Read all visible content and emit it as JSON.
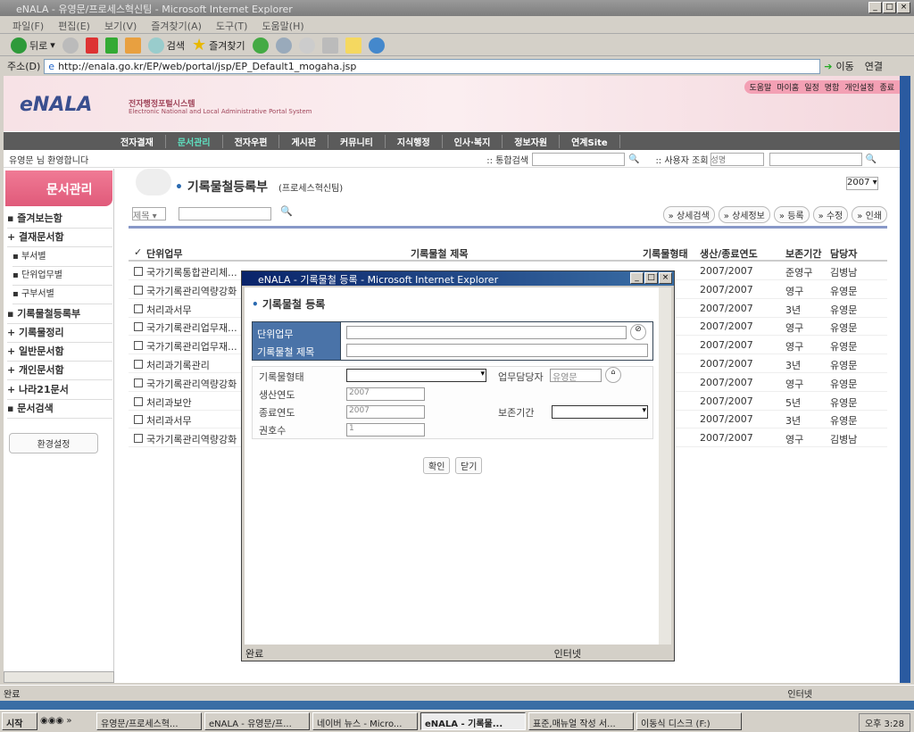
{
  "browser": {
    "title": "eNALA - 유영문/프로세스혁신팀 - Microsoft Internet Explorer",
    "menu": [
      "파일(F)",
      "편집(E)",
      "보기(V)",
      "즐겨찾기(A)",
      "도구(T)",
      "도움말(H)"
    ],
    "toolbar": {
      "back": "뒤로",
      "search": "검색",
      "favorites": "즐겨찾기"
    },
    "address_label": "주소(D)",
    "url": "http://enala.go.kr/EP/web/portal/jsp/EP_Default1_mogaha.jsp",
    "go": "이동",
    "links": "연결",
    "status": "완료",
    "zone": "인터넷"
  },
  "header": {
    "logo": "eNALA",
    "subtitle_ko": "전자행정포털시스템",
    "subtitle_en": "Electronic National and Local Administrative Portal System",
    "top_links": [
      "도움말",
      "마이홈",
      "일정",
      "명함",
      "개인설정",
      "종료"
    ]
  },
  "nav": [
    "전자결재",
    "문서관리",
    "전자우편",
    "게시판",
    "커뮤니티",
    "지식행정",
    "인사·복지",
    "정보자원",
    "연계Site"
  ],
  "welcome": "유영문 님 환영합니다",
  "search": {
    "label": ":: 통합검색",
    "user_label": ":: 사용자 조회",
    "user_select": "성명"
  },
  "sidebar": {
    "title": "문서관리",
    "items": [
      {
        "label": "즐겨보는함",
        "sub": false
      },
      {
        "label": "결재문서함",
        "sub": false
      },
      {
        "label": "부서별",
        "sub": true
      },
      {
        "label": "단위업무별",
        "sub": true
      },
      {
        "label": "구부서별",
        "sub": true
      },
      {
        "label": "기록물철등록부",
        "sub": false
      },
      {
        "label": "기록물정리",
        "sub": false
      },
      {
        "label": "일반문서함",
        "sub": false
      },
      {
        "label": "개인문서함",
        "sub": false
      },
      {
        "label": "나라21문서",
        "sub": false
      },
      {
        "label": "문서검색",
        "sub": false
      }
    ],
    "settings": "환경설정"
  },
  "main": {
    "title": "기록물철등록부",
    "team": "(프로세스혁신팀)",
    "year": "2007",
    "filter": "제목",
    "buttons": [
      "상세검색",
      "상세정보",
      "등록",
      "수정",
      "인쇄"
    ],
    "columns": [
      "단위업무",
      "기록물철 제목",
      "기록물형태",
      "생산/종료연도",
      "보존기간",
      "담당자"
    ],
    "rows": [
      [
        "국가기록통합관리체...",
        "2007/2007",
        "준영구",
        "김병남"
      ],
      [
        "국가기록관리역량강화",
        "2007/2007",
        "영구",
        "유영문"
      ],
      [
        "처리과서무",
        "2007/2007",
        "3년",
        "유영문"
      ],
      [
        "국가기록관리업무재...",
        "2007/2007",
        "영구",
        "유영문"
      ],
      [
        "국가기록관리업무재...",
        "2007/2007",
        "영구",
        "유영문"
      ],
      [
        "처리과기록관리",
        "2007/2007",
        "3년",
        "유영문"
      ],
      [
        "국가기록관리역량강화",
        "2007/2007",
        "영구",
        "유영문"
      ],
      [
        "처리과보안",
        "2007/2007",
        "5년",
        "유영문"
      ],
      [
        "처리과서무",
        "2007/2007",
        "3년",
        "유영문"
      ],
      [
        "국가기록관리역량강화",
        "2007/2007",
        "영구",
        "김병남"
      ]
    ]
  },
  "popup": {
    "title": "eNALA - 기록물철 등록 - Microsoft Internet Explorer",
    "heading": "기록물철 등록",
    "fields": {
      "unit_task": "단위업무",
      "file_title": "기록물철 제목",
      "type": "기록물형태",
      "owner": "업무담당자",
      "owner_value": "유영문",
      "prod_year": "생산연도",
      "prod_value": "2007",
      "end_year": "종료연도",
      "end_value": "2007",
      "retention": "보존기간",
      "volumes": "권호수",
      "volumes_value": "1"
    },
    "ok": "확인",
    "close": "닫기",
    "status": "완료",
    "zone": "인터넷"
  },
  "taskbar": {
    "start": "시작",
    "tasks": [
      "유영문/프로세스혁...",
      "eNALA - 유영문/프...",
      "네이버 뉴스 - Micro...",
      "eNALA - 기록물...",
      "표준,매뉴얼 작성 서...",
      "이동식 디스크 (F:)"
    ],
    "active": 3,
    "clock": "오후 3:28"
  }
}
